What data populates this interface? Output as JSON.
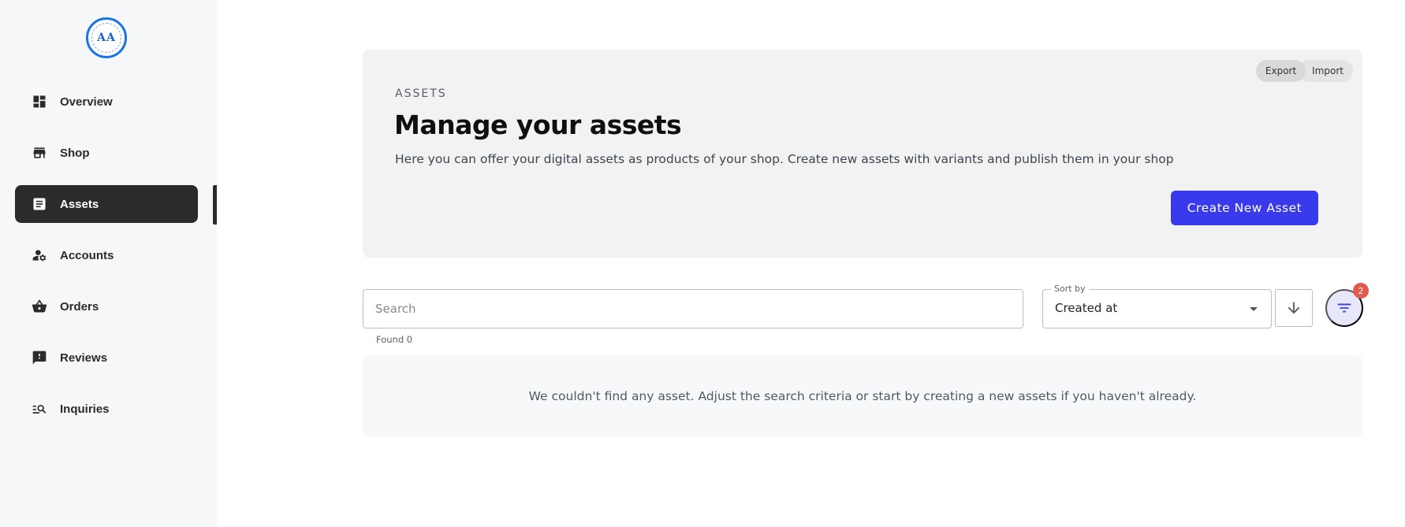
{
  "brand": {
    "logo_text": "AA"
  },
  "sidebar": {
    "items": [
      {
        "label": "Overview",
        "icon": "dashboard-icon",
        "active": false
      },
      {
        "label": "Shop",
        "icon": "store-icon",
        "active": false
      },
      {
        "label": "Assets",
        "icon": "document-icon",
        "active": true
      },
      {
        "label": "Accounts",
        "icon": "manage-accounts-icon",
        "active": false
      },
      {
        "label": "Orders",
        "icon": "basket-icon",
        "active": false
      },
      {
        "label": "Reviews",
        "icon": "feedback-icon",
        "active": false
      },
      {
        "label": "Inquiries",
        "icon": "search-list-icon",
        "active": false
      }
    ]
  },
  "header": {
    "overline": "ASSETS",
    "title": "Manage your assets",
    "description": "Here you can offer your digital assets as products of your shop. Create new assets with variants and publish them in your shop",
    "export_label": "Export",
    "import_label": "Import",
    "create_label": "Create New Asset"
  },
  "toolbar": {
    "search_placeholder": "Search",
    "found_text": "Found 0",
    "sort_label": "Sort by",
    "sort_value": "Created at",
    "sort_direction": "descending",
    "filter_count": "2"
  },
  "empty_state": {
    "message": "We couldn't find any asset. Adjust the search criteria or start by creating a new assets if you haven't already."
  },
  "colors": {
    "accent": "#3a3aed",
    "sidebar_active": "#2b2b2b",
    "badge": "#e05a4f"
  }
}
